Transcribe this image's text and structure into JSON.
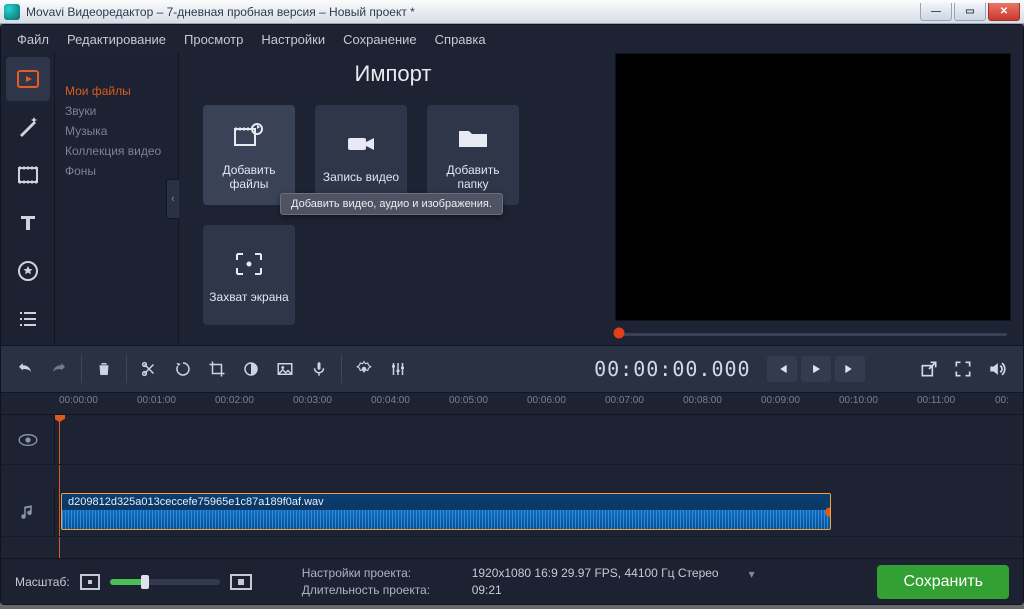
{
  "window": {
    "title": "Movavi Видеоредактор – 7-дневная пробная версия – Новый проект *"
  },
  "menubar": [
    "Файл",
    "Редактирование",
    "Просмотр",
    "Настройки",
    "Сохранение",
    "Справка"
  ],
  "categories": {
    "title": "Импорт",
    "items": [
      "Мои файлы",
      "Звуки",
      "Музыка",
      "Коллекция видео",
      "Фоны"
    ],
    "selected_index": 0
  },
  "tiles": [
    {
      "label": "Добавить файлы",
      "icon": "media-files"
    },
    {
      "label": "Запись видео",
      "icon": "camera"
    },
    {
      "label": "Добавить папку",
      "icon": "folder"
    },
    {
      "label": "Захват экрана",
      "icon": "screen-frame"
    }
  ],
  "tooltip": "Добавить видео, аудио и изображения.",
  "preview": {
    "timecode": "00:00:00.000"
  },
  "ruler": {
    "ticks": [
      "00:00:00",
      "00:01:00",
      "00:02:00",
      "00:03:00",
      "00:04:00",
      "00:05:00",
      "00:06:00",
      "00:07:00",
      "00:08:00",
      "00:09:00",
      "00:10:00",
      "00:11:00",
      "00:"
    ]
  },
  "clip": {
    "filename": "d209812d325a013ceccefe75965e1c87a189f0af.wav"
  },
  "status": {
    "zoom_label": "Масштаб:",
    "project_settings_label": "Настройки проекта:",
    "project_settings_value": "1920x1080 16:9 29.97 FPS, 44100 Гц Стерео",
    "duration_label": "Длительность проекта:",
    "duration_value": "09:21",
    "save_label": "Сохранить"
  }
}
